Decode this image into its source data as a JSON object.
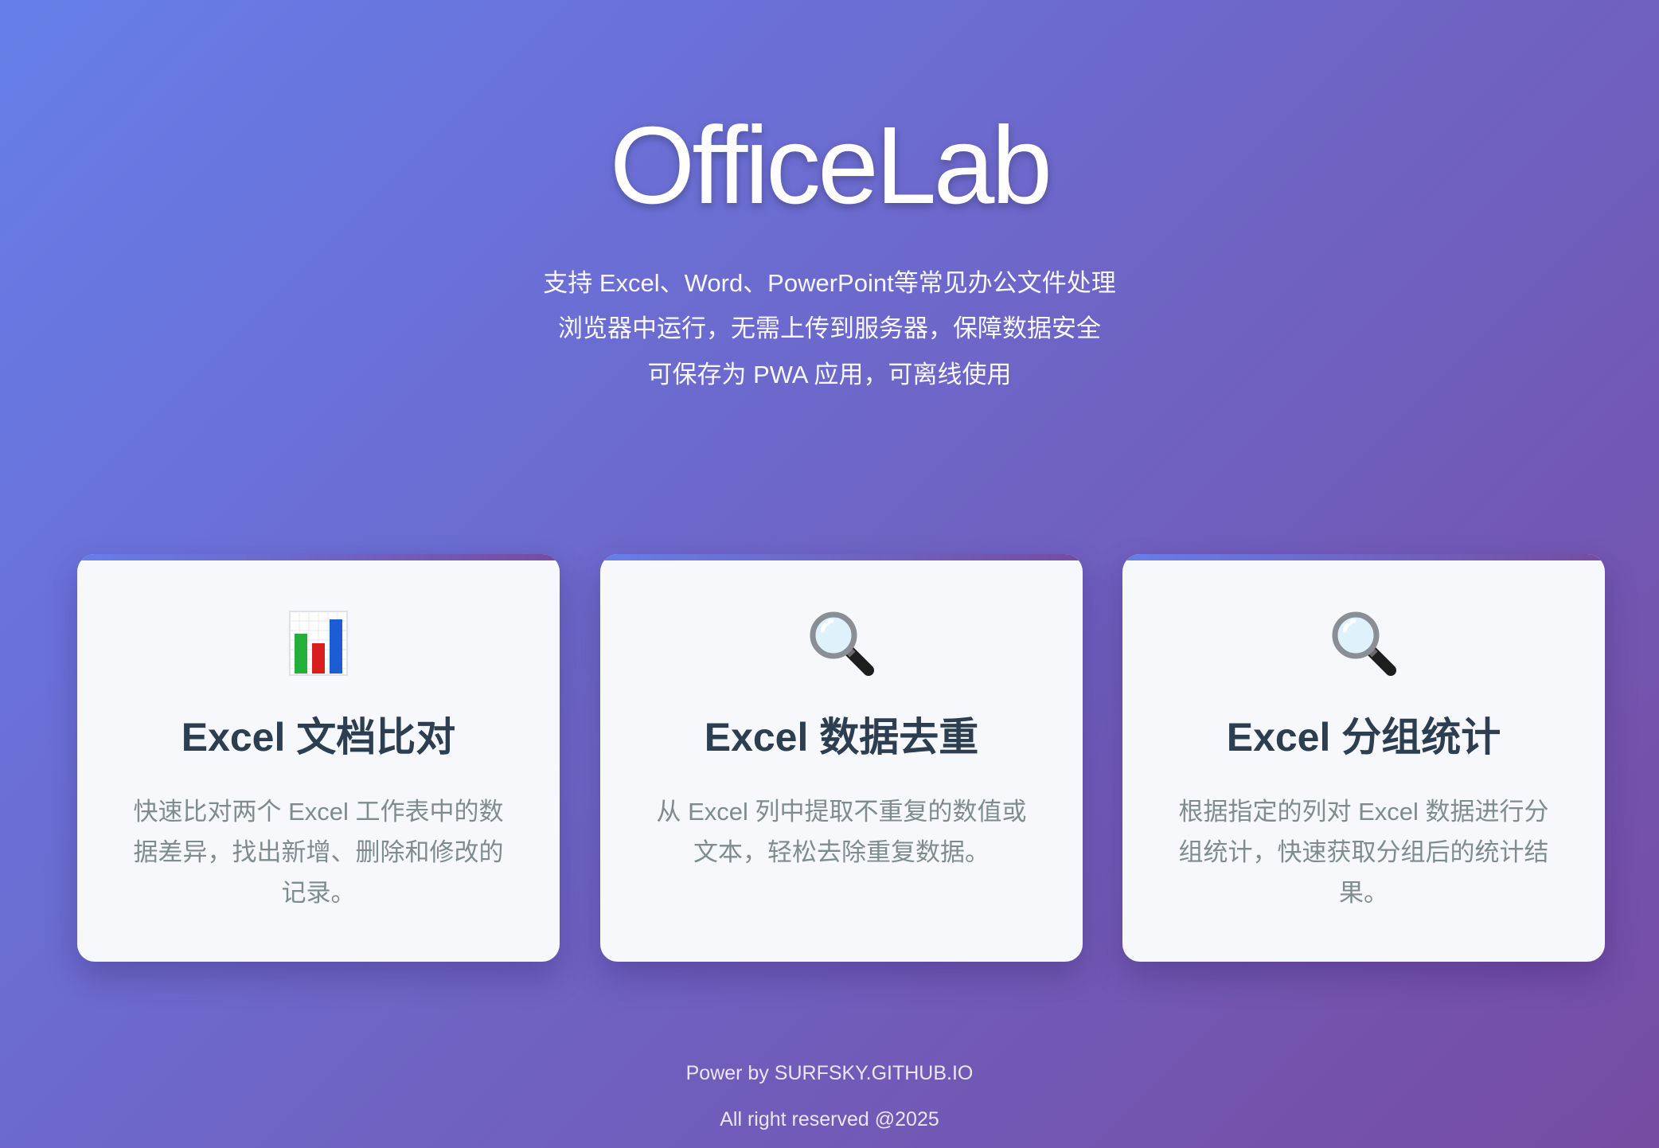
{
  "hero": {
    "title": "OfficeLab",
    "taglines": [
      "支持 Excel、Word、PowerPoint等常见办公文件处理",
      "浏览器中运行，无需上传到服务器，保障数据安全",
      "可保存为 PWA 应用，可离线使用"
    ]
  },
  "cards": [
    {
      "icon": "bar-chart-icon",
      "title": "Excel 文档比对",
      "description": "快速比对两个 Excel 工作表中的数据差异，找出新增、删除和修改的记录。"
    },
    {
      "icon": "magnifier-icon",
      "title": "Excel 数据去重",
      "description": "从 Excel 列中提取不重复的数值或文本，轻松去除重复数据。"
    },
    {
      "icon": "magnifier-icon",
      "title": "Excel 分组统计",
      "description": "根据指定的列对 Excel 数据进行分组统计，快速获取分组后的统计结果。"
    }
  ],
  "footer": {
    "powered": "Power by SURFSKY.GITHUB.IO",
    "copyright": "All right reserved @2025"
  },
  "colors": {
    "gradient_start": "#667eea",
    "gradient_end": "#764ba2",
    "card_background": "#f7f8fc",
    "card_title": "#2c3e50",
    "card_text": "#7f8c8d"
  }
}
